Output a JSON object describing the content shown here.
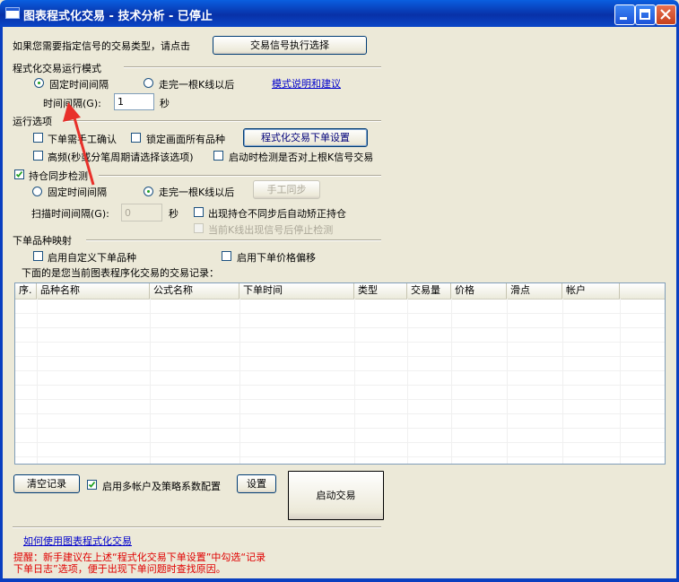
{
  "window": {
    "title": "图表程式化交易 - 技术分析 - 已停止"
  },
  "signal_select": {
    "prompt": "如果您需要指定信号的交易类型，请点击",
    "button": "交易信号执行选择"
  },
  "run_mode": {
    "header": "程式化交易运行模式",
    "option_fixed": "固定时间间隔",
    "option_kline": "走完一根K线以后",
    "link": "模式说明和建议",
    "interval_label": "时间间隔(G):",
    "interval_value": "1",
    "interval_unit": "秒"
  },
  "run_options": {
    "header": "运行选项",
    "manual_confirm": "下单需手工确认",
    "lock_all": "锁定画面所有品种",
    "order_settings_button": "程式化交易下单设置",
    "high_freq": "高频(秒或分笔周期请选择该选项)",
    "check_on_start": "启动时检测是否对上根K信号交易"
  },
  "position_sync": {
    "header": "持仓同步检测",
    "option_fixed": "固定时间间隔",
    "option_kline": "走完一根K线以后",
    "manual_sync_button": "手工同步",
    "scan_label": "扫描时间间隔(G):",
    "scan_value": "0",
    "scan_unit": "秒",
    "auto_correct": "出现持仓不同步后自动矫正持仓",
    "stop_check": "当前K线出现信号后停止检测"
  },
  "order_mapping": {
    "header": "下单品种映射",
    "custom_symbol": "启用自定义下单品种",
    "price_offset": "启用下单价格偏移",
    "records_label": "下面的是您当前图表程序化交易的交易记录："
  },
  "records_table": {
    "columns": [
      "序.",
      "品种名称",
      "公式名称",
      "下单时间",
      "类型",
      "交易量",
      "价格",
      "滑点",
      "帐户"
    ]
  },
  "bottom": {
    "clear_button": "清空记录",
    "multi_account": "启用多帐户及策略系数配置",
    "settings_button": "设置",
    "start_button": "启动交易",
    "howto_link": "如何使用图表程式化交易",
    "tip_line1": "提醒：新手建议在上述“程式化交易下单设置”中勾选“记录",
    "tip_line2": "下单日志”选项，便于出现下单问题时查找原因。"
  },
  "colors": {
    "title_bar": "#0a46c7",
    "annotation_arrow": "#e8302a",
    "tip_text": "#e00000"
  }
}
